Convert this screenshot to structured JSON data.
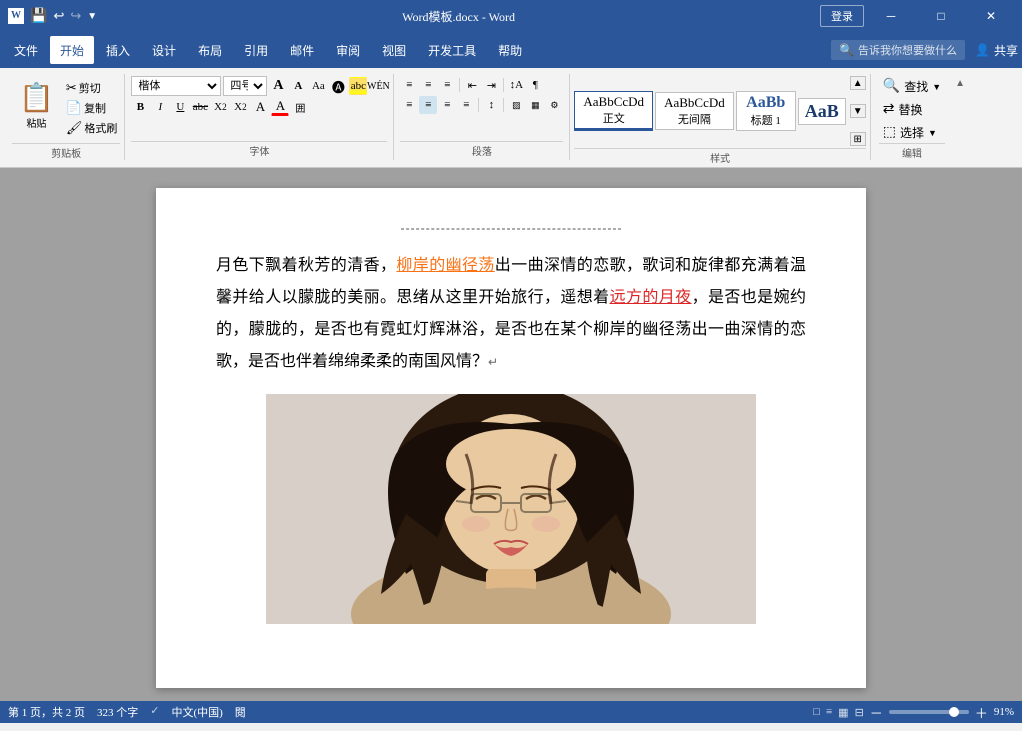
{
  "titlebar": {
    "title": "Word模板.docx - Word",
    "login_label": "登录",
    "save_icon": "💾",
    "undo_icon": "↩",
    "redo_icon": "↪",
    "customize_icon": "▼",
    "minimize_icon": "─",
    "restore_icon": "□",
    "close_icon": "✕"
  },
  "menubar": {
    "items": [
      "文件",
      "开始",
      "插入",
      "设计",
      "布局",
      "引用",
      "邮件",
      "审阅",
      "视图",
      "开发工具",
      "帮助"
    ],
    "active": "开始",
    "search_placeholder": "告诉我你想要做什么",
    "share_label": "共享"
  },
  "ribbon": {
    "clipboard": {
      "label": "剪贴板",
      "paste_label": "粘贴",
      "cut_label": "剪切",
      "copy_label": "复制",
      "format_painter_label": "格式刷"
    },
    "font": {
      "label": "字体",
      "font_name": "楷体",
      "font_size": "四号",
      "grow_label": "A",
      "shrink_label": "A",
      "case_label": "Aa",
      "clear_label": "A",
      "bold_label": "B",
      "italic_label": "I",
      "underline_label": "U",
      "strikethrough_label": "abc",
      "subscript_label": "X₂",
      "superscript_label": "X²",
      "highlight_label": "A",
      "color_label": "A"
    },
    "paragraph": {
      "label": "段落",
      "bullets_label": "≡",
      "numbering_label": "≡",
      "multilevel_label": "≡",
      "decrease_indent_label": "←",
      "increase_indent_label": "→",
      "sort_label": "↕",
      "show_marks_label": "¶",
      "align_left_label": "≡",
      "align_center_label": "≡",
      "align_right_label": "≡",
      "justify_label": "≡",
      "line_spacing_label": "↕",
      "shading_label": "▨",
      "border_label": "▦"
    },
    "styles": {
      "label": "样式",
      "normal_label": "正文",
      "no_spacing_label": "无间隔",
      "heading1_label": "标题 1"
    },
    "editing": {
      "label": "编辑",
      "find_label": "查找",
      "replace_label": "替换",
      "select_label": "选择"
    }
  },
  "document": {
    "text_before": "月色下飘着秋芳的清香，",
    "text_highlight1": "柳岸的幽径荡",
    "text_middle1": "出一曲深情的恋歌，歌词和旋律都充满着温馨并给人以朦胧的美丽。思绪从这里开始旅行，遥想着",
    "text_highlight2": "远方的月夜",
    "text_middle2": "，是否也是婉约的，朦胧的，是否也有霓虹灯辉淋浴，是否也在某个柳岸的幽径荡出一曲深情的恋歌，是否也伴着绵绵柔柔的南国风情？",
    "cursor_symbol": "↵"
  },
  "statusbar": {
    "page_info": "第 1 页，共 2 页",
    "word_count": "323 个字",
    "lang": "中文(中国)",
    "doc_mode": "閱",
    "zoom": "91%",
    "view_icons": [
      "□",
      "≡",
      "▦",
      "⊟"
    ]
  }
}
